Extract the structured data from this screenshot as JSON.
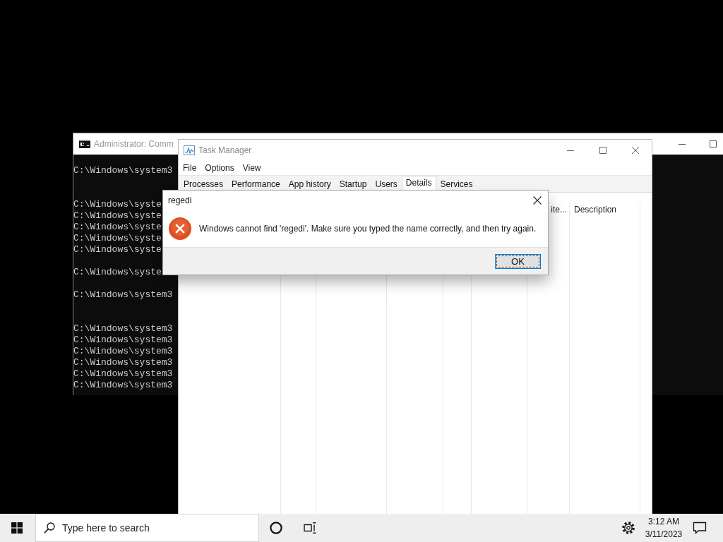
{
  "console_window": {
    "title": "Administrator: Comm",
    "lines": [
      {
        "kind": "text",
        "text": "C:\\Windows\\system3"
      },
      {
        "kind": "blank"
      },
      {
        "kind": "blank"
      },
      {
        "kind": "text",
        "text": "C:\\Windows\\syste"
      },
      {
        "kind": "text",
        "text": "C:\\Windows\\syste"
      },
      {
        "kind": "text",
        "text": "C:\\Windows\\syste"
      },
      {
        "kind": "text",
        "text": "C:\\Windows\\syste"
      },
      {
        "kind": "text",
        "text": "C:\\Windows\\syste"
      },
      {
        "kind": "blank"
      },
      {
        "kind": "text",
        "text": "C:\\Windows\\syste"
      },
      {
        "kind": "blank"
      },
      {
        "kind": "text",
        "text": "C:\\Windows\\system3"
      },
      {
        "kind": "blank"
      },
      {
        "kind": "blank"
      },
      {
        "kind": "text",
        "text": "C:\\Windows\\system3"
      },
      {
        "kind": "text",
        "text": "C:\\Windows\\system3"
      },
      {
        "kind": "text",
        "text": "C:\\Windows\\system3"
      },
      {
        "kind": "text",
        "text": "C:\\Windows\\system3"
      },
      {
        "kind": "text",
        "text": "C:\\Windows\\system3"
      },
      {
        "kind": "text",
        "text": "C:\\Windows\\system3"
      }
    ]
  },
  "task_manager": {
    "title": "Task Manager",
    "menu": [
      "File",
      "Options",
      "View"
    ],
    "tabs": [
      {
        "label": "Processes",
        "selected": false
      },
      {
        "label": "Performance",
        "selected": false
      },
      {
        "label": "App history",
        "selected": false
      },
      {
        "label": "Startup",
        "selected": false
      },
      {
        "label": "Users",
        "selected": false
      },
      {
        "label": "Details",
        "selected": true
      },
      {
        "label": "Services",
        "selected": false
      }
    ],
    "columns": [
      "ite...",
      "Description"
    ]
  },
  "dialog": {
    "title": "regedi",
    "message": "Windows cannot find 'regedi'. Make sure you typed the name correctly, and then try again.",
    "buttons": [
      {
        "label": "OK",
        "default": true
      }
    ]
  },
  "taskbar": {
    "search": {
      "placeholder": "Type here to search"
    },
    "clock": {
      "time": "3:12 AM",
      "date": "3/11/2023"
    }
  }
}
